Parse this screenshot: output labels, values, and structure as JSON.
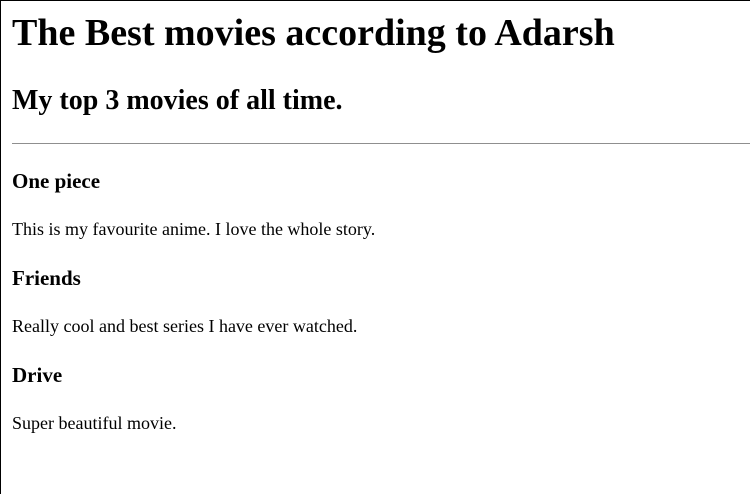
{
  "page": {
    "title": "The Best movies according to Adarsh",
    "subtitle": "My top 3 movies of all time."
  },
  "movies": [
    {
      "name": "One piece",
      "description": "This is my favourite anime. I love the whole story."
    },
    {
      "name": "Friends",
      "description": "Really cool and best series I have ever watched."
    },
    {
      "name": "Drive",
      "description": "Super beautiful movie."
    }
  ]
}
